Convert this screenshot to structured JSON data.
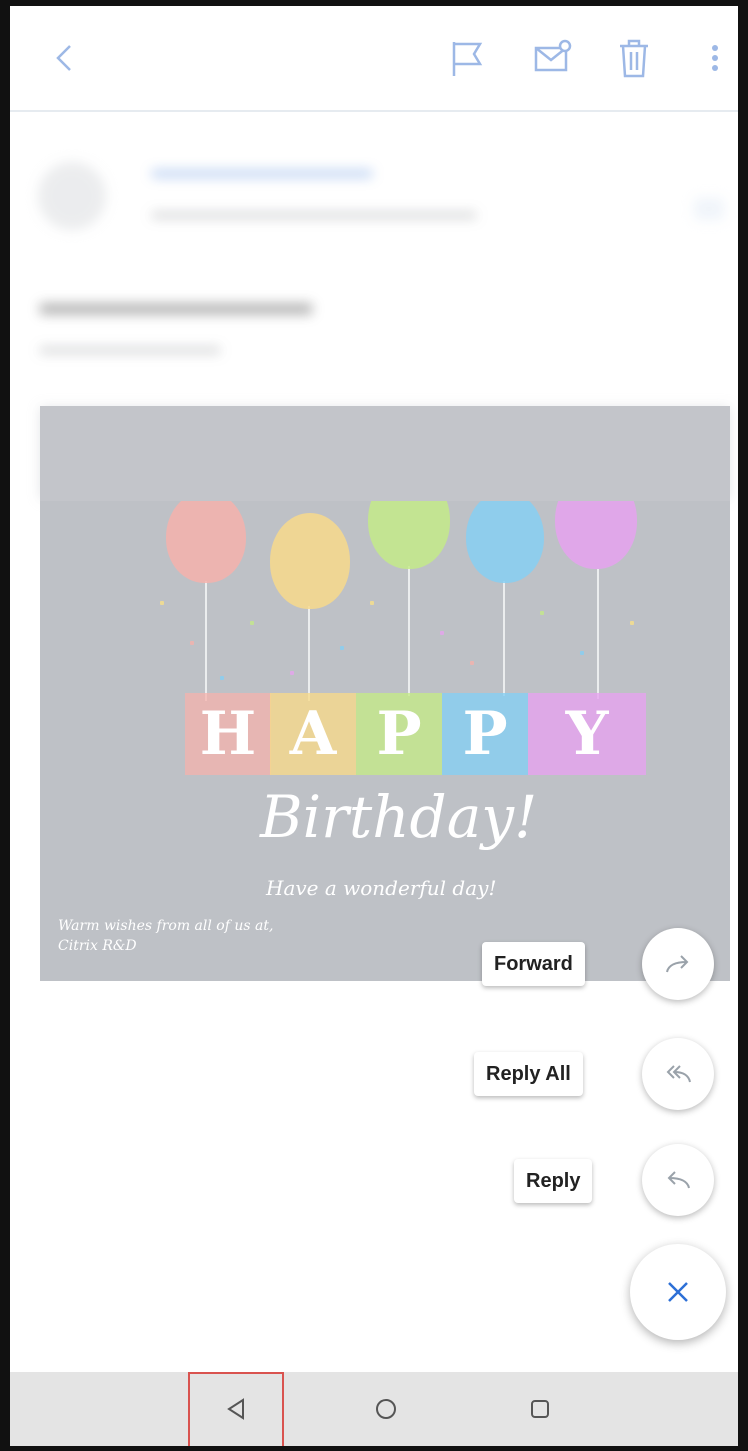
{
  "toolbar": {
    "back_icon": "chevron-left-icon",
    "flag_icon": "flag-icon",
    "mark_unread_icon": "envelope-dot-icon",
    "delete_icon": "trash-icon",
    "more_icon": "more-vertical-icon",
    "icon_color": "#2d6fd6"
  },
  "card": {
    "letters": [
      "H",
      "A",
      "P",
      "P",
      "Y"
    ],
    "birthday_text": "Birthday!",
    "tagline": "Have a wonderful day!",
    "wishes_line1": "Warm wishes from all of us at,",
    "wishes_line2": "Citrix R&D"
  },
  "actions": {
    "forward_label": "Forward",
    "reply_all_label": "Reply All",
    "reply_label": "Reply",
    "close_icon": "close-icon"
  },
  "navbar": {
    "back_icon": "triangle-back-icon",
    "home_icon": "circle-home-icon",
    "recents_icon": "square-recents-icon"
  }
}
